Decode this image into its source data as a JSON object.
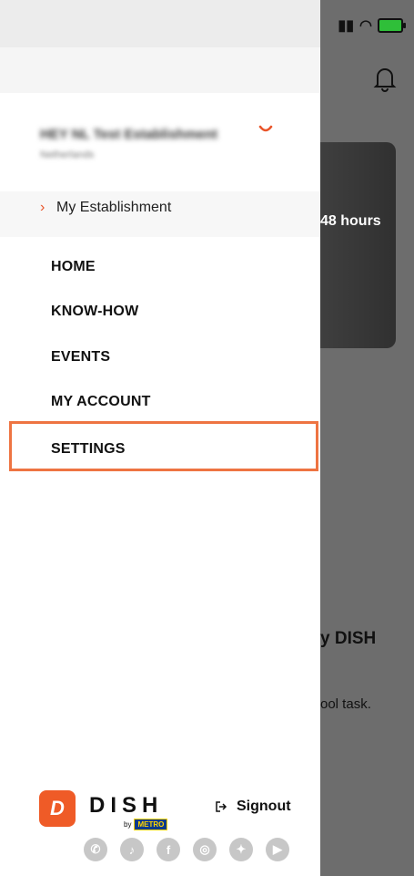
{
  "background": {
    "card_text": "48 hours",
    "heading": "y DISH",
    "subtext": "ool task."
  },
  "drawer": {
    "establishment": {
      "name": "HEY NL Test Establishment",
      "subtitle": "Netherlands",
      "my_establishment": "My Establishment"
    },
    "menu": [
      {
        "label": "HOME"
      },
      {
        "label": "KNOW-HOW"
      },
      {
        "label": "EVENTS"
      },
      {
        "label": "MY ACCOUNT"
      },
      {
        "label": "SETTINGS",
        "highlighted": true
      }
    ],
    "footer": {
      "logo_letter": "D",
      "brand": "DISH",
      "by": "by",
      "metro": "METRO",
      "signout": "Signout",
      "socials": [
        "whatsapp-icon",
        "tiktok-icon",
        "facebook-icon",
        "instagram-icon",
        "twitter-icon",
        "youtube-icon"
      ]
    }
  },
  "colors": {
    "accent": "#ef5b27",
    "highlight_border": "#ee7442"
  }
}
